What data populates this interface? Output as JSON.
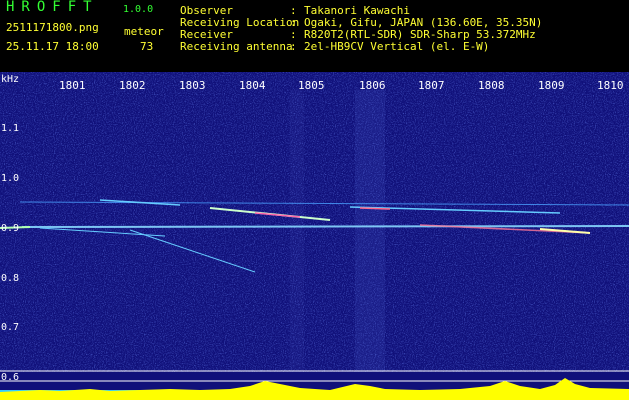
{
  "header": {
    "logo": "HROFFT",
    "version": "1.0.0",
    "filename": "2511171800.png",
    "datetime": "25.11.17 18:00",
    "meteor_label": "meteor",
    "meteor_count": "73",
    "info": [
      {
        "label": "Observer",
        "value": "Takanori Kawachi"
      },
      {
        "label": "Receiving Location",
        "value": "Ogaki, Gifu, JAPAN (136.60E, 35.35N)"
      },
      {
        "label": "Receiver",
        "value": "R820T2(RTL-SDR) SDR-Sharp 53.372MHz"
      },
      {
        "label": "Receiving antenna",
        "value": "2el-HB9CV Vertical (el. E-W)"
      }
    ],
    "colon": ":"
  },
  "axis": {
    "y_unit": "kHz",
    "x_ticks": [
      "1801",
      "1802",
      "1803",
      "1804",
      "1805",
      "1806",
      "1807",
      "1808",
      "1809",
      "1810"
    ],
    "y_ticks": [
      "1.1",
      "1.0",
      "0.9",
      "0.8",
      "0.7",
      "0.6"
    ]
  },
  "colors": {
    "background": "#10107a",
    "header_green": "#33ff33",
    "header_yellow": "#ffff33",
    "signal_cyan": "#66ccff",
    "power_yellow": "#ffff00",
    "power_cyan": "#33ccff"
  }
}
